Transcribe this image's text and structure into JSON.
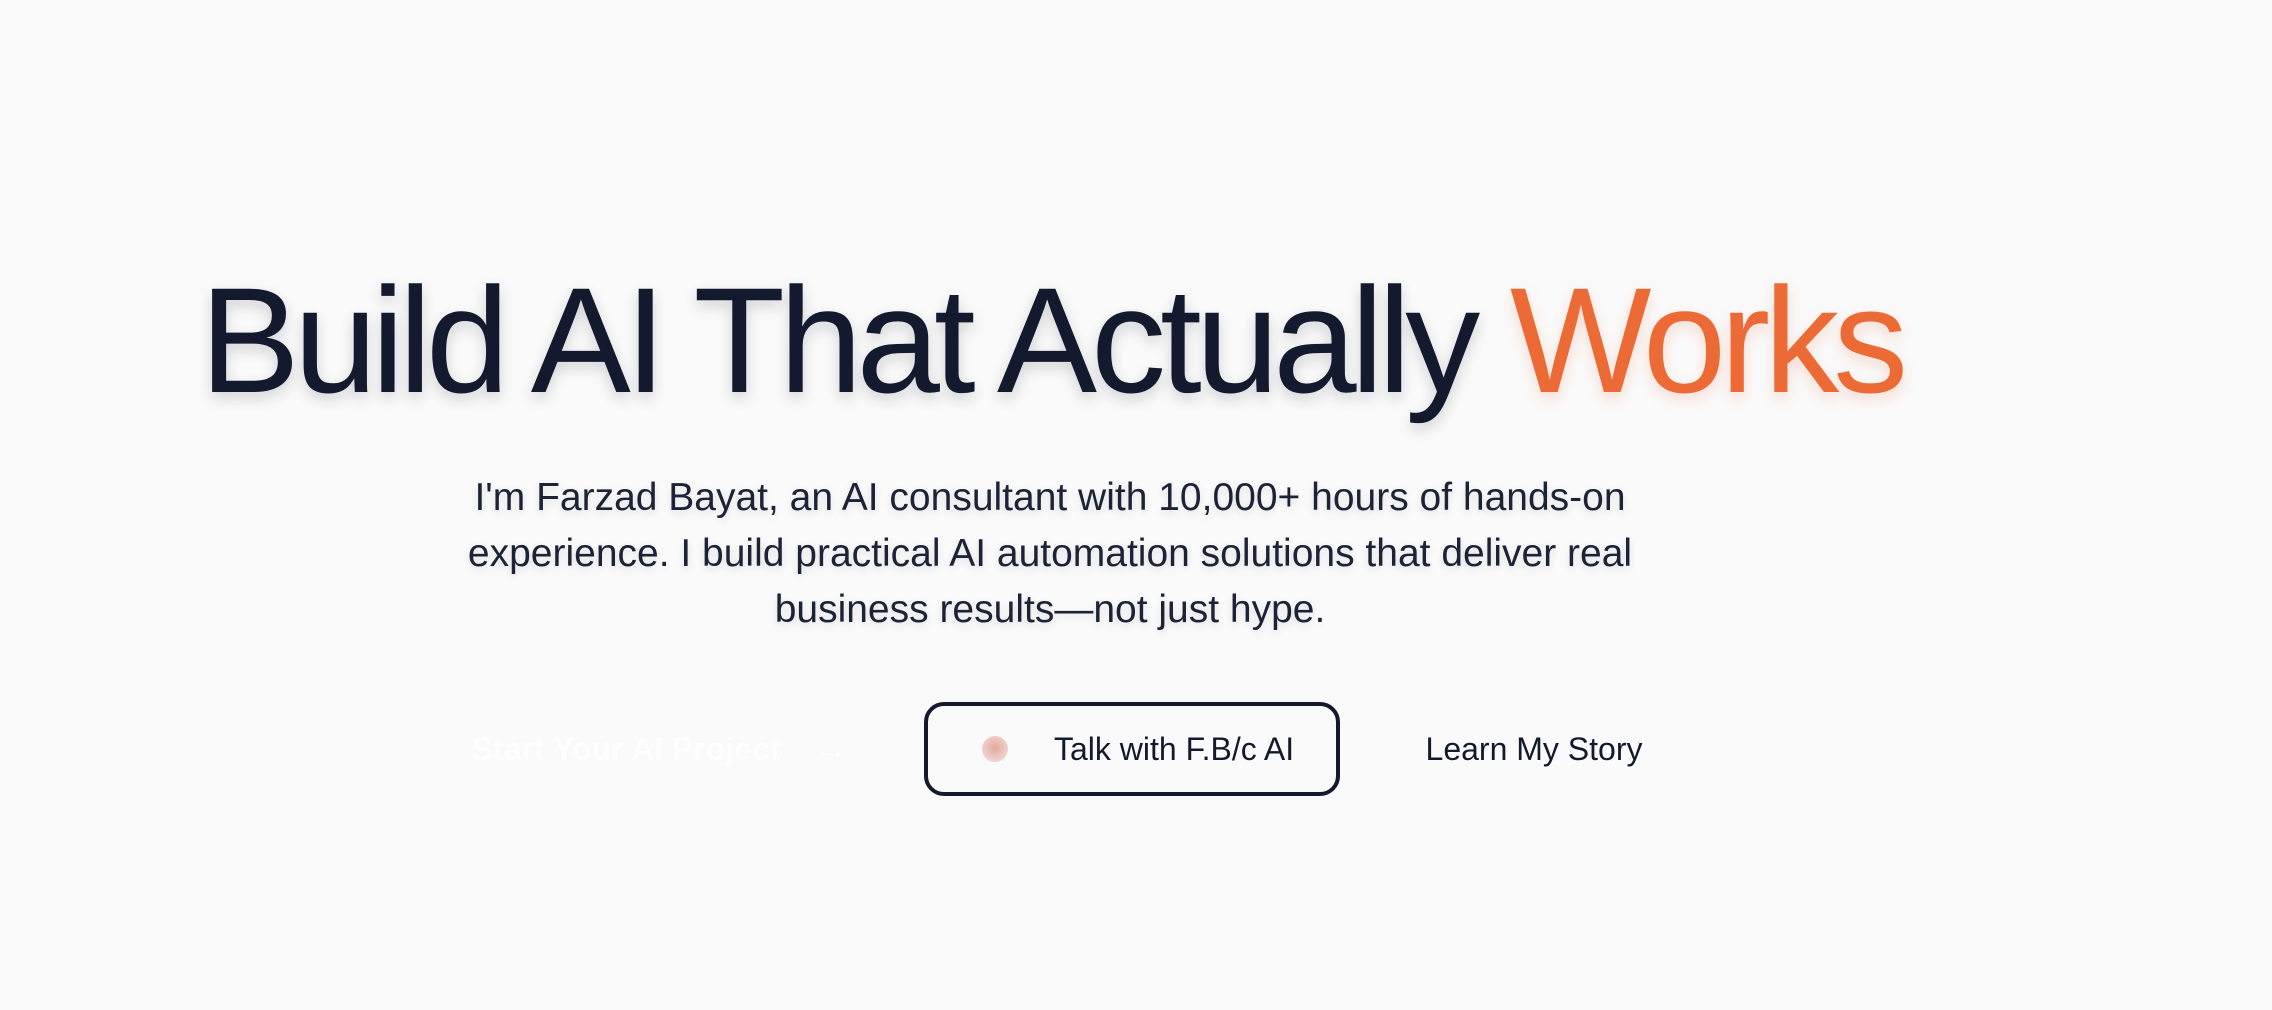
{
  "hero": {
    "headline_main": "Build AI That Actually",
    "headline_accent": "Works",
    "subtitle": "I'm Farzad Bayat, an AI consultant with 10,000+ hours of hands-on experience. I build practical AI automation solutions that deliver real business results—not just hype."
  },
  "cta": {
    "start_label": "Start Your AI Project",
    "start_icon": "arrow-right-icon",
    "talk_label": "Talk with F.B/c AI",
    "talk_icon": "avatar-orb",
    "story_label": "Learn My Story"
  },
  "colors": {
    "text_primary": "#141a2e",
    "accent": "#ec6a35",
    "background": "#fafafa"
  }
}
